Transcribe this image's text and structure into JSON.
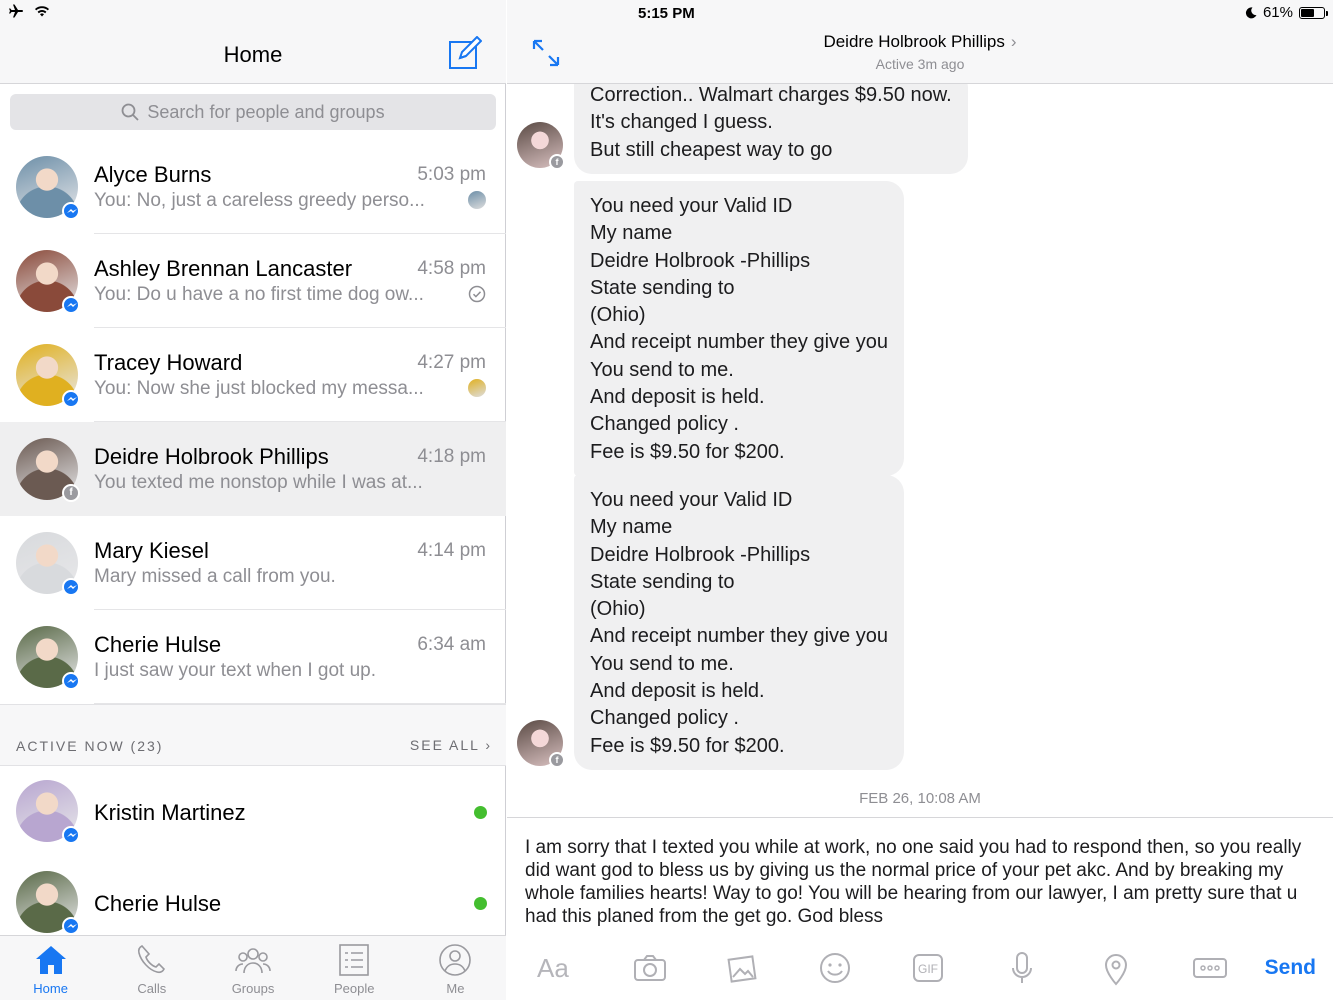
{
  "status_bar": {
    "time": "5:15 PM",
    "battery": "61%",
    "battery_level": 0.61
  },
  "left_header": {
    "title": "Home"
  },
  "search": {
    "placeholder": "Search for people and groups"
  },
  "conversations": [
    {
      "name": "Alyce Burns",
      "time": "5:03 pm",
      "preview": "You: No, just a careless greedy perso...",
      "badge": "messenger",
      "avatar_color": "#6d8fa8"
    },
    {
      "name": "Ashley Brennan Lancaster",
      "time": "4:58 pm",
      "preview": "You: Do u have a no first time dog ow...",
      "badge": "messenger",
      "avatar_color": "#8a4a3a"
    },
    {
      "name": "Tracey Howard",
      "time": "4:27 pm",
      "preview": "You: Now she just blocked my messa...",
      "badge": "messenger",
      "avatar_color": "#e0b020"
    },
    {
      "name": "Deidre Holbrook Phillips",
      "time": "4:18 pm",
      "preview": "You texted me nonstop while I was at...",
      "badge": "facebook",
      "avatar_color": "#6b5a52",
      "selected": true
    },
    {
      "name": "Mary Kiesel",
      "time": "4:14 pm",
      "preview": "Mary missed a call from you.",
      "badge": "messenger",
      "avatar_color": "#d8dadd"
    },
    {
      "name": "Cherie Hulse",
      "time": "6:34 am",
      "preview": "I just saw your text when I got up.",
      "badge": "messenger",
      "avatar_color": "#5a6a48"
    }
  ],
  "active_now": {
    "label": "ACTIVE NOW (23)",
    "see_all": "SEE ALL",
    "people": [
      {
        "name": "Kristin Martinez",
        "avatar_color": "#b8a6d0"
      },
      {
        "name": "Cherie Hulse",
        "avatar_color": "#5a6a48"
      }
    ]
  },
  "tabs": [
    {
      "label": "Home",
      "icon": "home-icon",
      "active": true
    },
    {
      "label": "Calls",
      "icon": "phone-icon"
    },
    {
      "label": "Groups",
      "icon": "groups-icon"
    },
    {
      "label": "People",
      "icon": "people-list-icon"
    },
    {
      "label": "Me",
      "icon": "profile-icon"
    }
  ],
  "thread": {
    "name": "Deidre Holbrook Phillips",
    "status": "Active 3m ago",
    "messages": [
      {
        "lines": [
          "Correction.. Walmart charges $9.50 now.",
          "It's changed I guess.",
          "But still cheapest way to go"
        ]
      },
      {
        "lines": [
          "You need your Valid ID",
          "My name",
          "Deidre Holbrook -Phillips",
          "State sending to",
          "(Ohio)",
          "And receipt number they give you",
          "You send to me.",
          "And deposit is held.",
          "Changed policy .",
          "Fee is $9.50 for $200."
        ]
      },
      {
        "lines": [
          "You need your Valid ID",
          "My name",
          "Deidre Holbrook -Phillips",
          "State sending to",
          "(Ohio)",
          "And receipt number they give you",
          "You send to me.",
          "And deposit is held.",
          "Changed policy .",
          "Fee is $9.50 for $200."
        ]
      }
    ],
    "date_separator": "FEB 26, 10:08 AM"
  },
  "composer": {
    "draft": "I am sorry that I texted you while at work, no one said you had to respond then, so you really did want god to bless us by giving us the normal price of your pet akc. And by breaking my whole families hearts! Way to go! You will be hearing from our lawyer, I am pretty sure that u had this planed from the get go. God bless",
    "text_tool": "Aa",
    "send_label": "Send"
  },
  "colors": {
    "accent": "#1877f2",
    "online": "#44be2f",
    "secondary_text": "#8e8e93",
    "bubble": "#f0f0f1"
  }
}
